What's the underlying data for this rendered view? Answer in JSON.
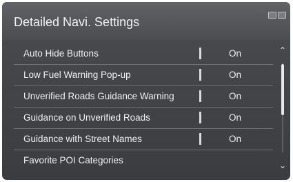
{
  "header": {
    "title": "Detailed Navi. Settings"
  },
  "settings": [
    {
      "label": "Auto Hide Buttons",
      "value": "On"
    },
    {
      "label": "Low Fuel Warning Pop-up",
      "value": "On"
    },
    {
      "label": "Unverified Roads Guidance Warning",
      "value": "On"
    },
    {
      "label": "Guidance on Unverified Roads",
      "value": "On"
    },
    {
      "label": "Guidance with Street Names",
      "value": "On"
    },
    {
      "label": "Favorite POI Categories",
      "value": ""
    }
  ],
  "icons": {
    "scroll_up": "chevron-up-icon",
    "scroll_down": "chevron-down-icon",
    "status": "status-icons"
  }
}
